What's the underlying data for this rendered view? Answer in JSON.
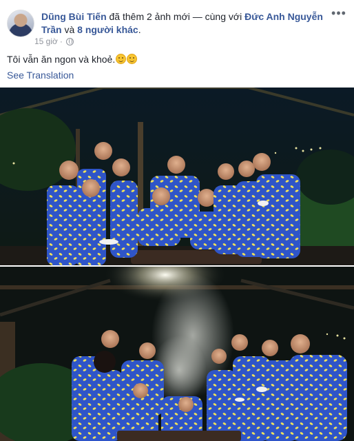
{
  "post": {
    "author": "Dũng Bùi Tiến",
    "action_text": "đã thêm 2 ảnh mới — cùng với",
    "tagged_person": "Đức Anh Nguyễn Trần",
    "and_text": "và",
    "others": "8 người khác",
    "time": "15 giờ",
    "more_icon": "more-options-icon",
    "privacy_icon": "globe-icon",
    "caption": "Tôi vẫn ăn ngon và khoẻ.",
    "see_translation": "See Translation"
  },
  "photos": [
    {
      "name": "group-photo-night"
    },
    {
      "name": "group-photo-grill"
    }
  ],
  "colors": {
    "link": "#385898",
    "text": "#1d2129",
    "meta": "#90949c",
    "shirt_blue": "#2f55c8",
    "lemon": "#f2e35a"
  }
}
